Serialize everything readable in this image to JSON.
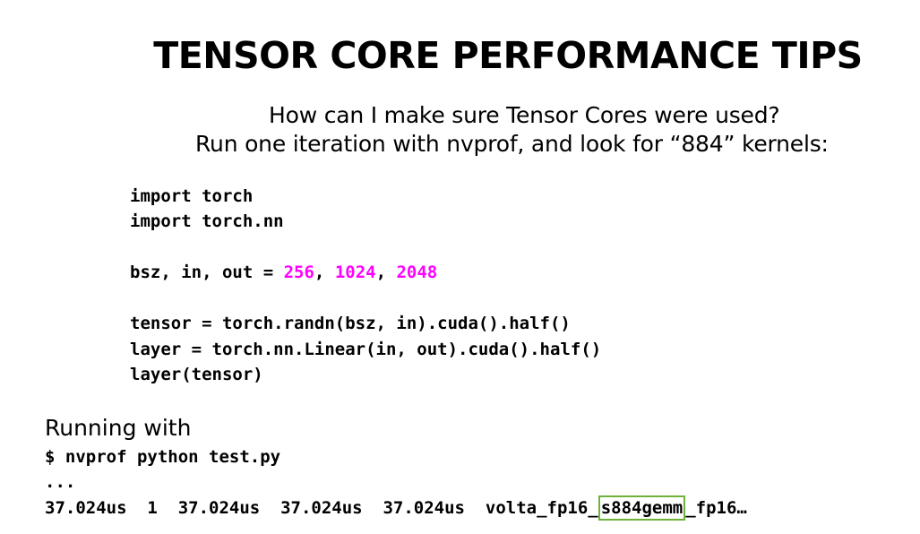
{
  "slide": {
    "title": "TENSOR CORE PERFORMANCE TIPS",
    "subtitle_line1": "How can I make sure Tensor Cores were used?",
    "subtitle_line2": "Run one iteration with nvprof, and look for “884” kernels:"
  },
  "code": {
    "line1": "import torch",
    "line2": "import torch.nn",
    "line3_prefix": "bsz, in, out = ",
    "bsz_value": "256",
    "sep1": ", ",
    "in_value": "1024",
    "sep2": ", ",
    "out_value": "2048",
    "line4": "tensor = torch.randn(bsz, in).cuda().half()",
    "line5": "layer = torch.nn.Linear(in, out).cuda().half()",
    "line6": "layer(tensor)"
  },
  "output": {
    "running_label": "Running with",
    "command": "$ nvprof python test.py",
    "ellipsis": "...",
    "row_prefix": "37.024us  1  37.024us  37.024us  37.024us  volta_fp16_",
    "kernel_highlight": "s884gemm",
    "row_suffix": "_fp16…"
  },
  "colors": {
    "number_highlight": "#ff00ff",
    "box_highlight": "#6fb23a"
  }
}
